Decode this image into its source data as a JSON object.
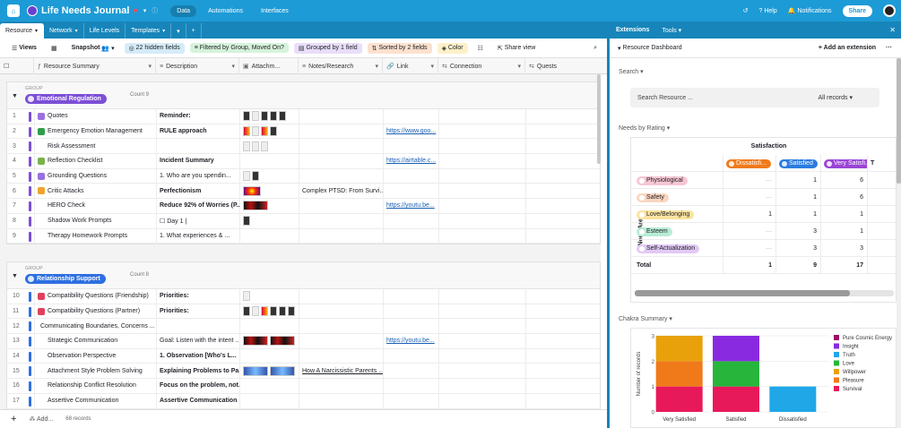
{
  "topbar": {
    "base_title": "Life Needs Journal",
    "tabs": [
      "Data",
      "Automations",
      "Interfaces"
    ],
    "active_tab": "Data",
    "help": "Help",
    "notifications": "Notifications",
    "share": "Share"
  },
  "table_tabs": [
    {
      "label": "Resource",
      "active": true
    },
    {
      "label": "Network"
    },
    {
      "label": "Life Levels"
    },
    {
      "label": "Templates"
    }
  ],
  "toolbar": {
    "views": "Views",
    "snapshot": "Snapshot",
    "hidden": "22 hidden fields",
    "filtered": "Filtered by Group, Moved On?",
    "grouped": "Grouped by 1 field",
    "sorted": "Sorted by 2 fields",
    "color": "Color",
    "share_view": "Share view"
  },
  "columns": [
    "Resource Summary",
    "Description",
    "Attachm...",
    "Notes/Research",
    "Link",
    "Connection",
    "Quests"
  ],
  "groups": [
    {
      "label": "GROUP",
      "name": "Emotional Regulation",
      "color": "#7c4fd6",
      "count": "Count 9",
      "rows": [
        {
          "n": "1",
          "summary": "Quotes",
          "icon": "#9a6fe0",
          "desc": "Reminder:",
          "bold": true,
          "att": "dark5",
          "notes": "",
          "link": ""
        },
        {
          "n": "2",
          "summary": "Emergency Emotion Management",
          "icon": "#2e9e4a",
          "desc": "RULE approach",
          "bold": true,
          "att": "mixed4",
          "notes": "",
          "link": "https://www.goo..."
        },
        {
          "n": "3",
          "summary": "Risk Assessment",
          "icon": "",
          "desc": "",
          "bold": false,
          "att": "light3",
          "notes": "",
          "link": ""
        },
        {
          "n": "4",
          "summary": "Reflection Checklist",
          "icon": "#7ab24a",
          "desc": "Incident Summary",
          "bold": true,
          "att": "",
          "notes": "",
          "link": "https://airtable.c..."
        },
        {
          "n": "5",
          "summary": "Grounding Questions",
          "icon": "#9a6fe0",
          "desc": "1.  Who are you spendin...",
          "bold": false,
          "att": "light2",
          "notes": "",
          "link": ""
        },
        {
          "n": "6",
          "summary": "Critic Attacks",
          "icon": "#f0a32b",
          "desc": "Perfectionism",
          "bold": true,
          "att": "heat",
          "notes": "Complex PTSD: From Survi...",
          "link": ""
        },
        {
          "n": "7",
          "summary": "HERO Check",
          "icon": "",
          "desc": "Reduce 92% of Worries (P...",
          "bold": true,
          "att": "wide",
          "notes": "",
          "link": "https://youtu.be..."
        },
        {
          "n": "8",
          "summary": "Shadow Work Prompts",
          "icon": "",
          "desc": "☐  Day 1 |",
          "bold": false,
          "att": "dark1",
          "notes": "",
          "link": ""
        },
        {
          "n": "9",
          "summary": "Therapy Homework Prompts",
          "icon": "",
          "desc": "1.  What experiences & ...",
          "bold": false,
          "att": "",
          "notes": "",
          "link": ""
        }
      ]
    },
    {
      "label": "GROUP",
      "name": "Relationship Support",
      "color": "#2f6fe0",
      "count": "Count 8",
      "rows": [
        {
          "n": "10",
          "summary": "Compatibility Questions (Friendship)",
          "icon": "#e0405a",
          "desc": "Priorities:",
          "bold": true,
          "att": "phone1",
          "notes": "",
          "link": ""
        },
        {
          "n": "11",
          "summary": "Compatibility Questions (Partner)",
          "icon": "#e0405a",
          "desc": "Priorities:",
          "bold": true,
          "att": "dark6",
          "notes": "",
          "link": ""
        },
        {
          "n": "12",
          "summary": "Communicating Boundaries, Concerns ...",
          "icon": "",
          "desc": "",
          "bold": false,
          "att": "",
          "notes": "",
          "link": ""
        },
        {
          "n": "13",
          "summary": "Strategic Communication",
          "icon": "",
          "desc": "Goal: Listen with the intent ...",
          "bold": false,
          "att": "wide2",
          "notes": "",
          "link": "https://youtu.be..."
        },
        {
          "n": "14",
          "summary": "Observation Perspective",
          "icon": "",
          "desc": "1.  Observation [Who's L...",
          "bold": true,
          "att": "",
          "notes": "",
          "link": ""
        },
        {
          "n": "15",
          "summary": "Attachment Style Problem Solving",
          "icon": "",
          "desc": "Explaining Problems to Pa...",
          "bold": true,
          "att": "blue2",
          "notes": "How A Narcissistic Parents ...",
          "link": ""
        },
        {
          "n": "16",
          "summary": "Relationship Conflict Resolution",
          "icon": "",
          "desc": "Focus on the problem, not...",
          "bold": true,
          "att": "",
          "notes": "",
          "link": ""
        },
        {
          "n": "17",
          "summary": "Assertive Communication",
          "icon": "",
          "desc": "Assertive Communication",
          "bold": true,
          "att": "",
          "notes": "",
          "link": ""
        }
      ]
    }
  ],
  "footer": {
    "add": "Add...",
    "records": "68 records"
  },
  "panel": {
    "tabs": [
      "Extensions",
      "Tools"
    ],
    "title": "Resource Dashboard",
    "add_extension": "Add an extension",
    "search_label": "Search",
    "search_value": "Search  Resource  ...",
    "search_scope": "All records",
    "needs_label": "Needs by Rating",
    "pivot_title": "Satisfaction",
    "row_axis": "Need Area",
    "pivot_cols": [
      {
        "label": "Dissatisfi...",
        "color": "#f07a1a"
      },
      {
        "label": "Satisfied",
        "color": "#2b7de0"
      },
      {
        "label": "Very Satisfi...",
        "color": "#9a45d6"
      },
      {
        "label": "T",
        "color": ""
      }
    ],
    "pivot_rows": [
      {
        "label": "Physiological",
        "color": "#f7c6d3",
        "v": [
          "",
          "1",
          "6"
        ]
      },
      {
        "label": "Safety",
        "color": "#fbd5c0",
        "v": [
          "",
          "1",
          "6"
        ]
      },
      {
        "label": "Love/Belonging",
        "color": "#fbe3a0",
        "v": [
          "1",
          "1",
          "1"
        ]
      },
      {
        "label": "Esteem",
        "color": "#b8ecd7",
        "v": [
          "",
          "3",
          "1"
        ]
      },
      {
        "label": "Self-Actualization",
        "color": "#e1c9f5",
        "v": [
          "",
          "3",
          "3"
        ]
      }
    ],
    "pivot_total": {
      "label": "Total",
      "v": [
        "1",
        "9",
        "17"
      ]
    },
    "chakra_label": "Chakra Summary"
  },
  "chart_data": {
    "type": "bar",
    "categories": [
      "Very Satisfied",
      "Satisfied",
      "Dissatisfied"
    ],
    "ylabel": "Number of records",
    "ylim": [
      0,
      3
    ],
    "series": [
      {
        "name": "Survival",
        "color": "#e8195a",
        "values": [
          1,
          1,
          0
        ]
      },
      {
        "name": "Pleasure",
        "color": "#f07a1a",
        "values": [
          1,
          0,
          0
        ]
      },
      {
        "name": "Willpower",
        "color": "#e8a10a",
        "values": [
          1,
          0,
          0
        ]
      },
      {
        "name": "Love",
        "color": "#27b53c",
        "values": [
          0,
          1,
          0
        ]
      },
      {
        "name": "Truth",
        "color": "#1fa7e8",
        "values": [
          0,
          0,
          1
        ]
      },
      {
        "name": "Insight",
        "color": "#8a2ae0",
        "values": [
          0,
          1,
          0
        ]
      },
      {
        "name": "Pure Cosmic Energy",
        "color": "#9c0d6a",
        "values": [
          0,
          0,
          0
        ]
      }
    ],
    "legend": [
      "Pure Cosmic Energy",
      "Insight",
      "Truth",
      "Love",
      "Willpower",
      "Pleasure",
      "Survival"
    ]
  }
}
